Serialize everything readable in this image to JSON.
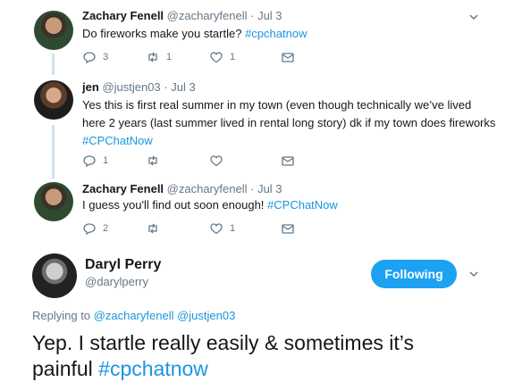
{
  "tweets": [
    {
      "name": "Zachary Fenell",
      "handle": "@zacharyfenell",
      "separator": "·",
      "date": "Jul 3",
      "text": "Do fireworks make you startle?",
      "hashtag": "#cpchatnow",
      "replies": "3",
      "retweets": "1",
      "likes": "1"
    },
    {
      "name": "jen",
      "handle": "@justjen03",
      "separator": "·",
      "date": "Jul 3",
      "text_line1": "Yes this is first real summer in my town (even though technically we’ve lived",
      "text_line2": "here 2 years (last summer lived in rental long story) dk if my town does fireworks",
      "hashtag": "#CPChatNow",
      "replies": "1",
      "retweets": "",
      "likes": ""
    },
    {
      "name": "Zachary Fenell",
      "handle": "@zacharyfenell",
      "separator": "·",
      "date": "Jul 3",
      "text": "I guess you'll find out soon enough!",
      "hashtag": "#CPChatNow",
      "replies": "2",
      "retweets": "",
      "likes": "1"
    }
  ],
  "main_tweet": {
    "name": "Daryl Perry",
    "handle": "@darylperry",
    "follow_label": "Following",
    "replying_prefix": "Replying to",
    "replying_to": "@zacharyfenell @justjen03",
    "text_line1": "Yep. I startle really easily & sometimes it’s",
    "text_line2": "painful",
    "hashtag": "#cpchatnow"
  },
  "colors": {
    "accent": "#1da1f2",
    "link": "#1b95e0",
    "thread_line": "#cfe3f2",
    "muted": "#657786"
  }
}
